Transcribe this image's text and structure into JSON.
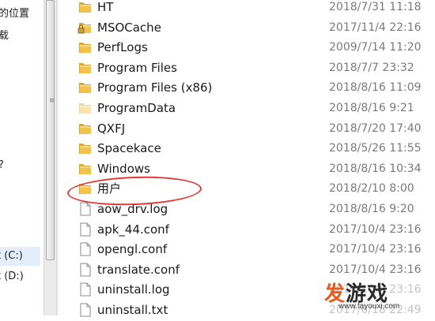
{
  "nav": {
    "partial_top1": "的位置",
    "partial_top2": "载",
    "partial_mid": "?",
    "drive_c": "t (C:)",
    "drive_d": "t (D:)"
  },
  "files": [
    {
      "name": "HT",
      "date": "2018/7/31 11:18",
      "type": "folder"
    },
    {
      "name": "MSOCache",
      "date": "2017/11/4 22:16",
      "type": "folder-locked"
    },
    {
      "name": "PerfLogs",
      "date": "2009/7/14 11:20",
      "type": "folder"
    },
    {
      "name": "Program Files",
      "date": "2018/7/7 23:32",
      "type": "folder"
    },
    {
      "name": "Program Files (x86)",
      "date": "2018/8/16 11:09",
      "type": "folder"
    },
    {
      "name": "ProgramData",
      "date": "2018/8/16 9:21",
      "type": "folder-faded"
    },
    {
      "name": "QXFJ",
      "date": "2018/7/20 17:40",
      "type": "folder"
    },
    {
      "name": "Spacekace",
      "date": "2018/5/26 11:55",
      "type": "folder"
    },
    {
      "name": "Windows",
      "date": "2018/8/16 10:34",
      "type": "folder"
    },
    {
      "name": "用户",
      "date": "2018/2/10 8:00",
      "type": "folder"
    },
    {
      "name": "aow_drv.log",
      "date": "2018/8/16 9:20",
      "type": "file"
    },
    {
      "name": "apk_44.conf",
      "date": "2017/10/4 23:16",
      "type": "file"
    },
    {
      "name": "opengl.conf",
      "date": "2017/10/4 23:16",
      "type": "file"
    },
    {
      "name": "translate.conf",
      "date": "2017/10/4 23:16",
      "type": "file"
    },
    {
      "name": "uninstall.log",
      "date": "2017/10/4 23:16",
      "type": "file"
    },
    {
      "name": "uninstall.txt",
      "date": "2017/6/18 22:49",
      "type": "file"
    }
  ],
  "watermark": {
    "logo_fa": "发",
    "logo_rest": "游戏",
    "url": "www.fayouxi.com"
  },
  "colors": {
    "highlight": "#e03a3a",
    "folder": "#f2c24f",
    "brand": "#ea5a1c"
  }
}
